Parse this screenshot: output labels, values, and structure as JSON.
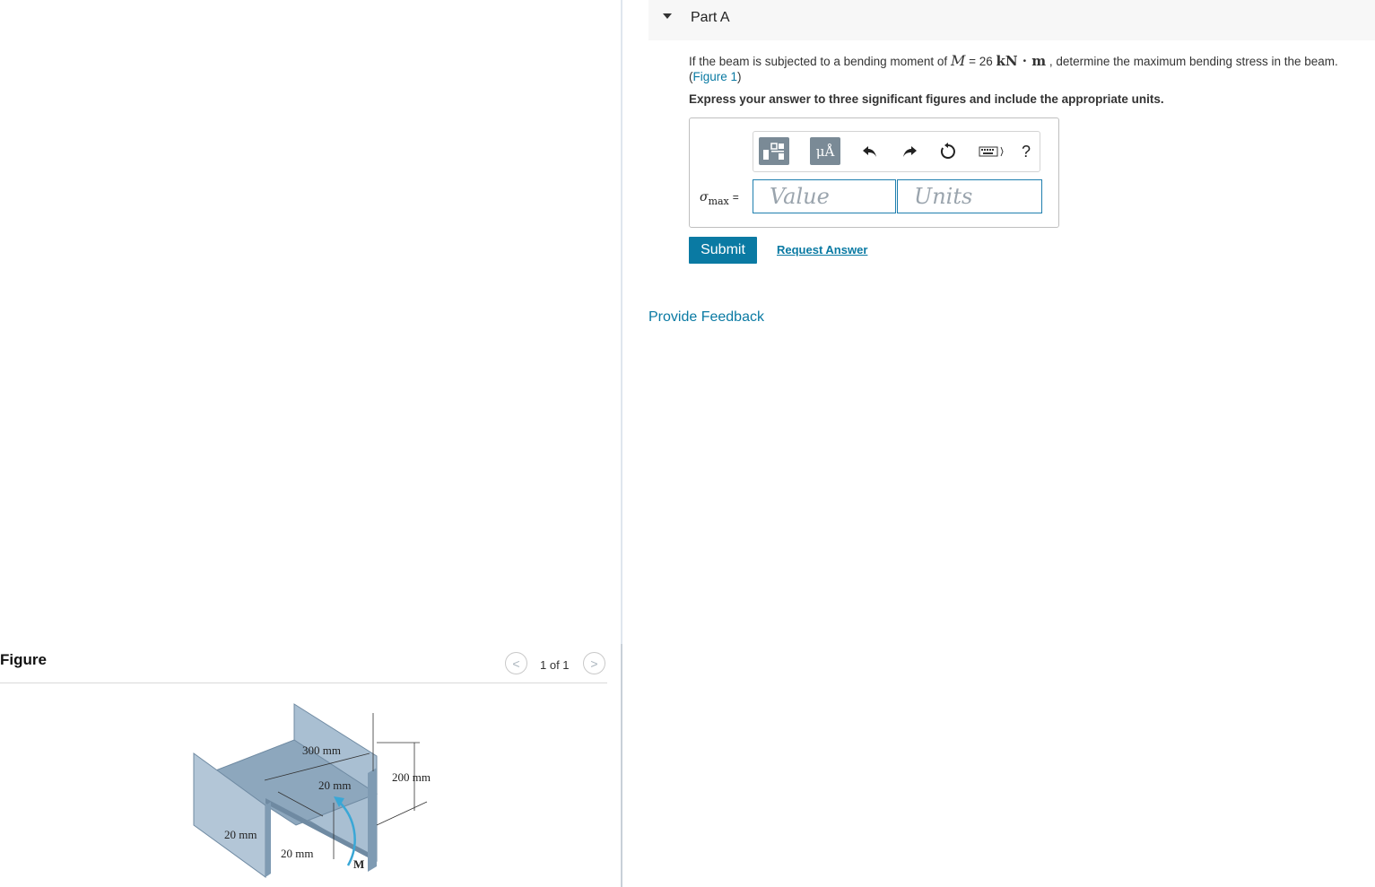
{
  "part": {
    "title": "Part A"
  },
  "question": {
    "prefix": "If the beam is subjected to a bending moment of ",
    "var": "M",
    "equals": " = 26 ",
    "unit": "kN · m",
    "suffix": " , determine the maximum bending stress in the beam.",
    "figure_link": "Figure 1",
    "instruction": "Express your answer to three significant figures and include the appropriate units."
  },
  "answer": {
    "variable": "σ",
    "subscript": "max",
    "equals": "=",
    "value_placeholder": "Value",
    "units_placeholder": "Units"
  },
  "toolbar": {
    "units_button": "μÅ",
    "help": "?"
  },
  "actions": {
    "submit": "Submit",
    "request_answer": "Request Answer",
    "provide_feedback": "Provide Feedback"
  },
  "figure": {
    "title": "Figure",
    "page": "1 of 1",
    "labels": {
      "width": "300 mm",
      "height": "200 mm",
      "web": "20 mm",
      "flange_left": "20 mm",
      "flange_bottom": "20 mm",
      "moment": "M"
    }
  },
  "colors": {
    "accent": "#0a7aa3",
    "beam_face": "#a9bfd2",
    "beam_dark": "#7f9bb3",
    "arrow": "#3aa7d6"
  }
}
